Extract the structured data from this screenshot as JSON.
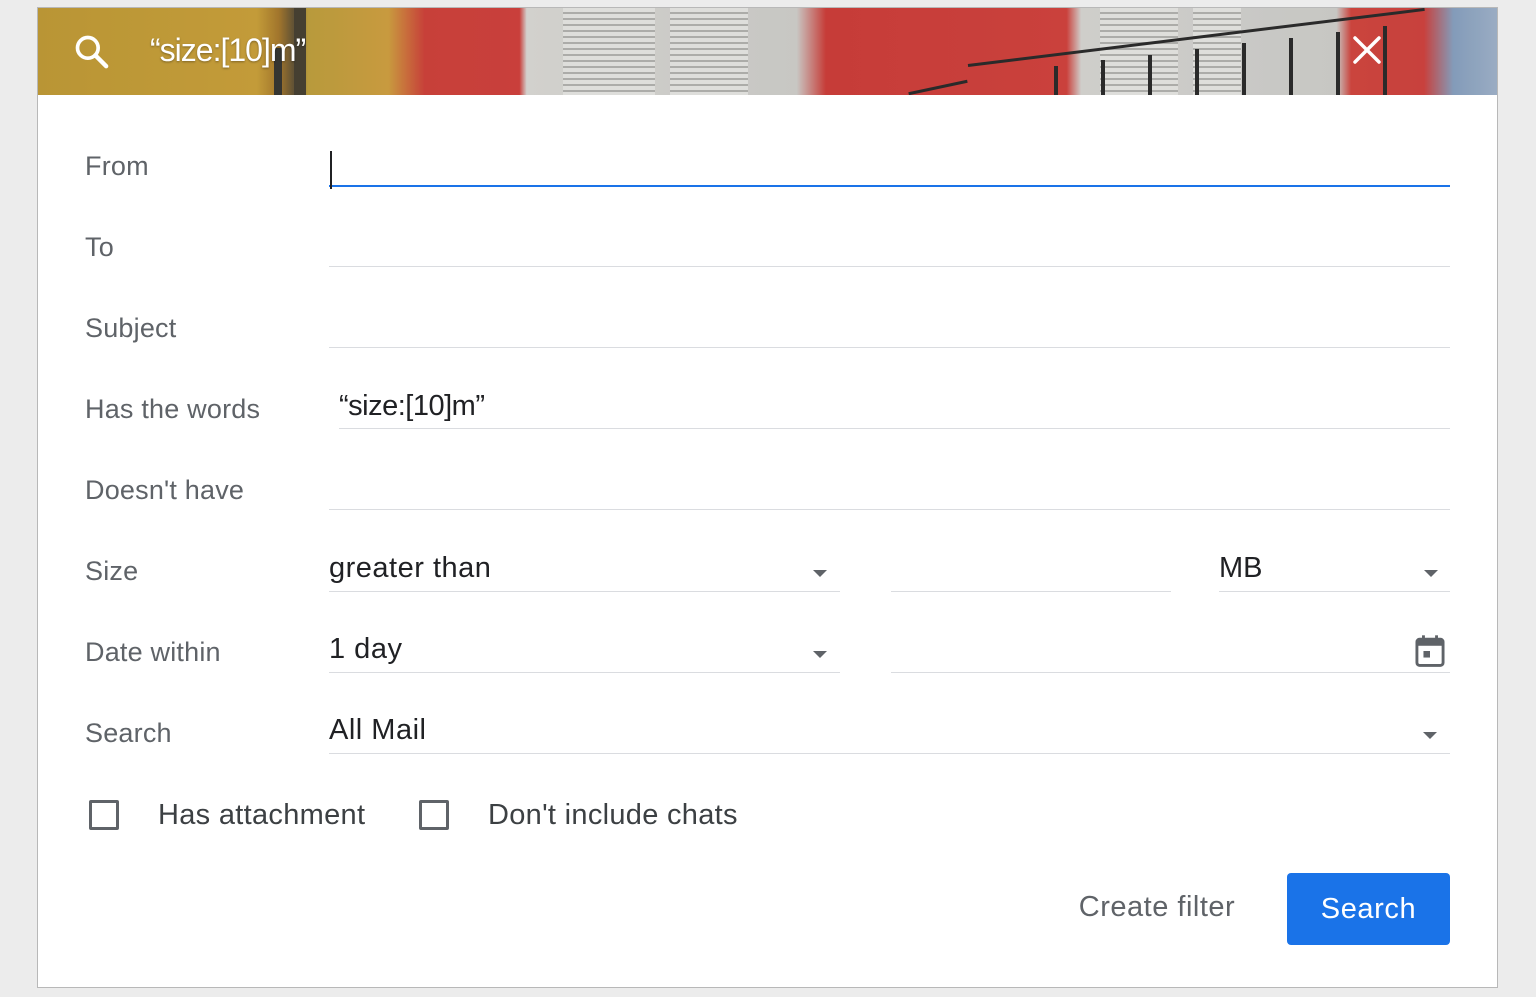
{
  "header": {
    "query": "“size:[10]m”",
    "search_icon": "search-icon",
    "close_icon": "close-icon"
  },
  "form": {
    "from": {
      "label": "From",
      "value": ""
    },
    "to": {
      "label": "To",
      "value": ""
    },
    "subject": {
      "label": "Subject",
      "value": ""
    },
    "has_words": {
      "label": "Has the words",
      "value": "“size:[10]m”"
    },
    "doesnt_have": {
      "label": "Doesn't have",
      "value": ""
    },
    "size": {
      "label": "Size",
      "operator": "greater than",
      "amount": "",
      "unit": "MB"
    },
    "date_within": {
      "label": "Date within",
      "range": "1 day",
      "date": "",
      "calendar_icon": "calendar-icon"
    },
    "search_in": {
      "label": "Search",
      "value": "All Mail"
    }
  },
  "checkboxes": {
    "has_attachment": {
      "label": "Has attachment",
      "checked": false
    },
    "dont_include_chats": {
      "label": "Don't include chats",
      "checked": false
    }
  },
  "actions": {
    "create_filter": "Create filter",
    "search": "Search"
  },
  "colors": {
    "accent": "#1a73e8",
    "label_text": "#5f6368",
    "value_text": "#202124",
    "divider": "#dadce0"
  }
}
